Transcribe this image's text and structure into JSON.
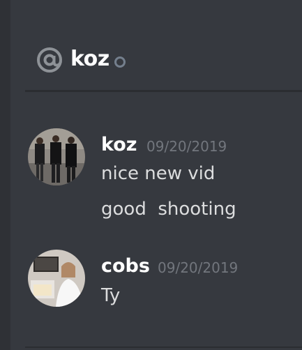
{
  "header": {
    "channel_icon": "at-icon",
    "channel_name": "koz",
    "status": "offline"
  },
  "messages": [
    {
      "author": "koz",
      "timestamp": "09/20/2019",
      "lines": [
        "nice new vid",
        "good  shooting"
      ]
    },
    {
      "author": "cobs",
      "timestamp": "09/20/2019",
      "lines": [
        "Ty"
      ]
    }
  ],
  "colors": {
    "background": "#36393f",
    "author": "#ffffff",
    "timestamp": "#72767d",
    "message_text": "#dcddde",
    "status_offline": "#747f8d"
  }
}
